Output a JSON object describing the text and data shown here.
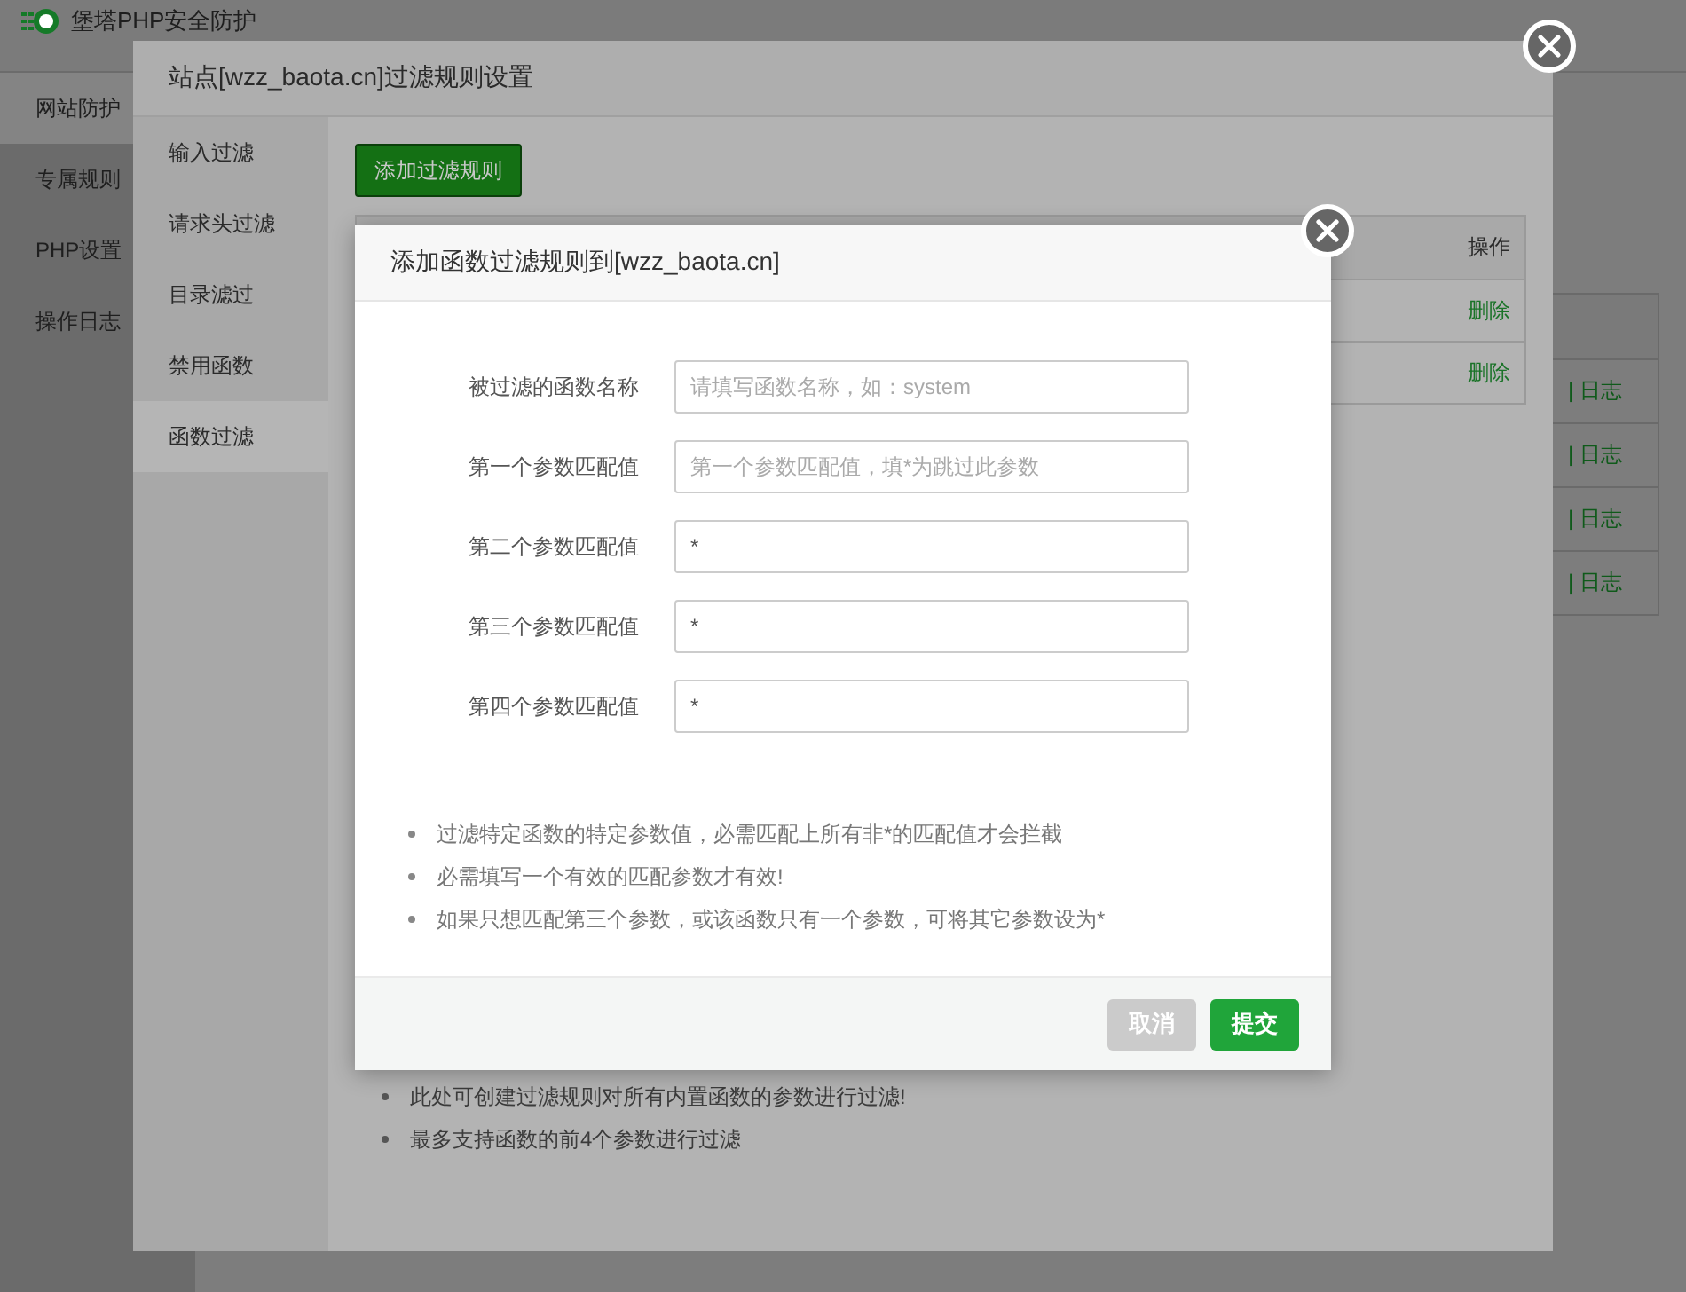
{
  "app": {
    "title": "堡塔PHP安全防护",
    "nav": [
      {
        "label": "网站防护",
        "selected": true
      },
      {
        "label": "专属规则",
        "selected": false
      },
      {
        "label": "PHP设置",
        "selected": false
      },
      {
        "label": "操作日志",
        "selected": false
      }
    ],
    "table_links": [
      "| 日志",
      "| 日志",
      "| 日志",
      "| 日志"
    ]
  },
  "filter_dialog": {
    "title": "站点[wzz_baota.cn]过滤规则设置",
    "tabs": [
      {
        "label": "输入过滤",
        "selected": false
      },
      {
        "label": "请求头过滤",
        "selected": false
      },
      {
        "label": "目录滤过",
        "selected": false
      },
      {
        "label": "禁用函数",
        "selected": false
      },
      {
        "label": "函数过滤",
        "selected": true
      }
    ],
    "add_button": "添加过滤规则",
    "table": {
      "columns": [
        "操作"
      ],
      "rows": [
        [
          "删除"
        ],
        [
          "删除"
        ]
      ]
    },
    "notes": [
      "此处可创建过滤规则对所有内置函数的参数进行过滤!",
      "最多支持函数的前4个参数进行过滤"
    ]
  },
  "modal": {
    "title": "添加函数过滤规则到[wzz_baota.cn]",
    "fields": [
      {
        "label": "被过滤的函数名称",
        "placeholder": "请填写函数名称，如：system"
      },
      {
        "label": "第一个参数匹配值",
        "placeholder": "第一个参数匹配值，填*为跳过此参数"
      },
      {
        "label": "第二个参数匹配值",
        "value": "*"
      },
      {
        "label": "第三个参数匹配值",
        "value": "*"
      },
      {
        "label": "第四个参数匹配值",
        "value": "*"
      }
    ],
    "tips": [
      "过滤特定函数的特定参数值，必需匹配上所有非*的匹配值才会拦截",
      "必需填写一个有效的匹配参数才有效!",
      "如果只想匹配第三个参数，或该函数只有一个参数，可将其它参数设为*"
    ],
    "buttons": [
      {
        "label": "取消",
        "kind": "cancel"
      },
      {
        "label": "提交",
        "kind": "submit"
      }
    ]
  }
}
